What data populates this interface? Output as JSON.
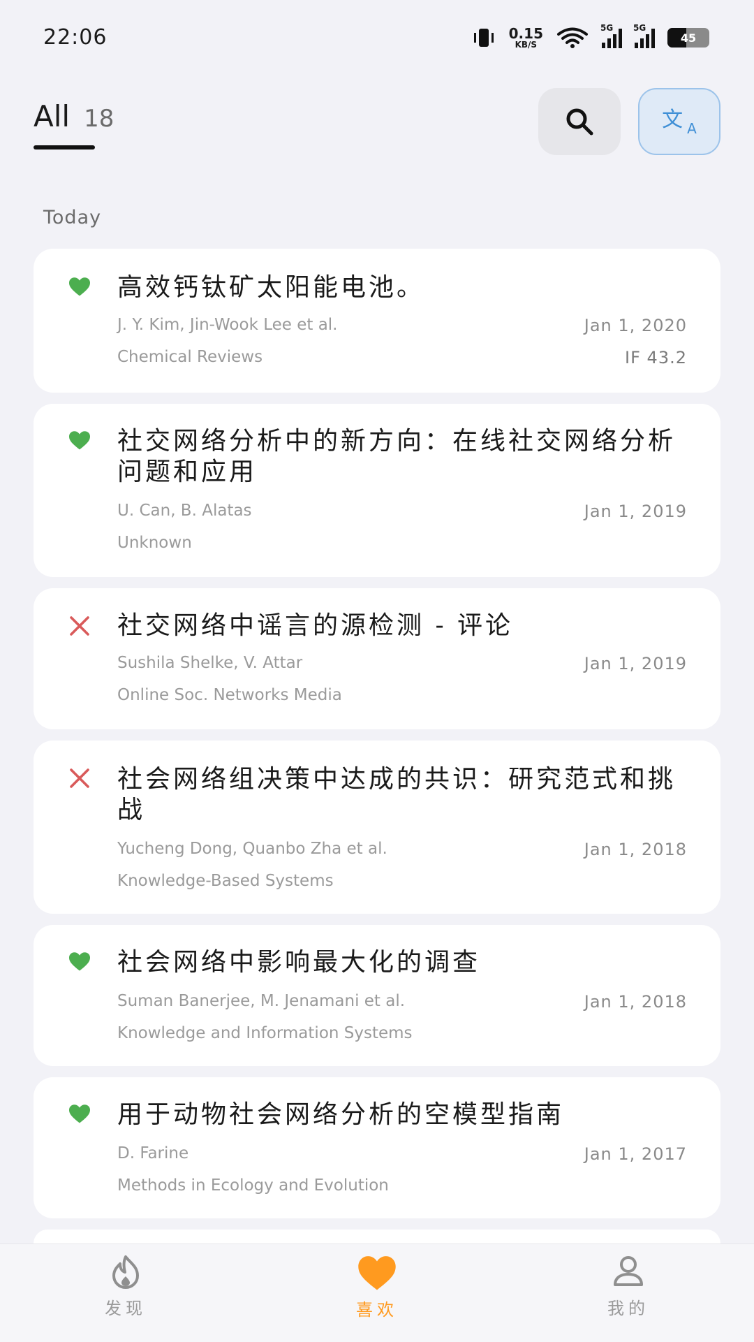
{
  "status_bar": {
    "time": "22:06",
    "net_speed_value": "0.15",
    "net_speed_unit": "KB/S",
    "signal_1_label": "5G",
    "signal_2_label": "5G",
    "battery_level": "45"
  },
  "header": {
    "tab_label": "All",
    "tab_count": "18",
    "translate_icon_zh": "文",
    "translate_icon_en": "A"
  },
  "section_title": "Today",
  "papers": [
    {
      "status": "liked",
      "title": "高效钙钛矿太阳能电池。",
      "authors": "J. Y. Kim, Jin-Wook Lee et al.",
      "date": "Jan 1, 2020",
      "journal": "Chemical Reviews",
      "impact": "IF 43.2"
    },
    {
      "status": "liked",
      "title": "社交网络分析中的新方向：在线社交网络分析问题和应用",
      "authors": "U. Can, B. Alatas",
      "date": "Jan 1, 2019",
      "journal": "Unknown",
      "impact": ""
    },
    {
      "status": "disliked",
      "title": "社交网络中谣言的源检测 - 评论",
      "authors": "Sushila Shelke, V. Attar",
      "date": "Jan 1, 2019",
      "journal": "Online Soc. Networks Media",
      "impact": ""
    },
    {
      "status": "disliked",
      "title": "社会网络组决策中达成的共识：研究范式和挑战",
      "authors": "Yucheng Dong, Quanbo Zha et al.",
      "date": "Jan 1, 2018",
      "journal": "Knowledge-Based Systems",
      "impact": ""
    },
    {
      "status": "liked",
      "title": "社会网络中影响最大化的调查",
      "authors": "Suman Banerjee, M. Jenamani et al.",
      "date": "Jan 1, 2018",
      "journal": "Knowledge and Information Systems",
      "impact": ""
    },
    {
      "status": "liked",
      "title": "用于动物社会网络分析的空模型指南",
      "authors": "D. Farine",
      "date": "Jan 1, 2017",
      "journal": "Methods in Ecology and Evolution",
      "impact": ""
    }
  ],
  "bottom_nav": {
    "discover": "发现",
    "favorites": "喜欢",
    "mine": "我的"
  },
  "colors": {
    "background": "#f2f2f7",
    "liked": "#4cae4f",
    "disliked": "#d95a5a",
    "accent_active": "#ff9a1f",
    "translate_accent": "#3f8fd6"
  }
}
